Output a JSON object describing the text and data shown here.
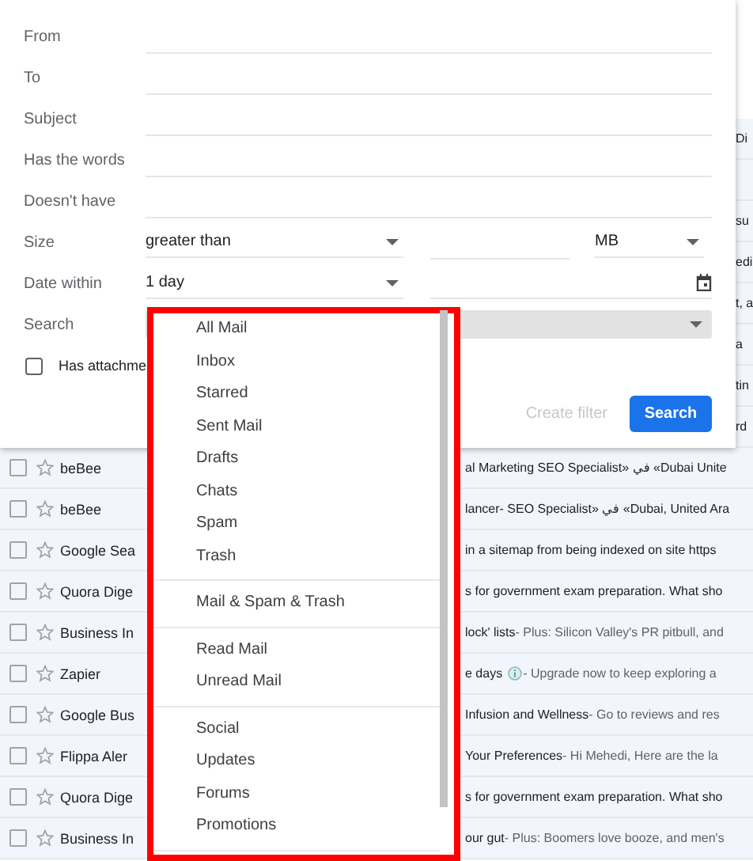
{
  "mail_list": {
    "rows": [
      {
        "kind": "covered",
        "edge_text": "Di"
      },
      {
        "kind": "covered"
      },
      {
        "kind": "covered",
        "edge_text": "su"
      },
      {
        "kind": "covered",
        "edge_text": "edi"
      },
      {
        "kind": "covered",
        "edge_text": "t, a"
      },
      {
        "kind": "covered",
        "edge_text": "a"
      },
      {
        "kind": "covered",
        "edge_text": "tin"
      },
      {
        "kind": "covered",
        "edge_text": "rd"
      },
      {
        "kind": "email",
        "checked": false,
        "sender": "beBee",
        "subject": "al Marketing SEO Specialist» في «Dubai Unite"
      },
      {
        "kind": "email",
        "checked": false,
        "sender": "beBee",
        "subject": "lancer- SEO Specialist» في «Dubai, United Ara"
      },
      {
        "kind": "email",
        "checked": false,
        "sender": "Google Sea",
        "subject": "in a sitemap from being indexed on site https"
      },
      {
        "kind": "email",
        "checked": false,
        "sender": "Quora Dige",
        "subject": "s for government exam preparation. What sho"
      },
      {
        "kind": "email",
        "checked": false,
        "sender": "Business In",
        "subject": "lock' lists",
        "snippet": " - Plus: Silicon Valley's PR pitbull, and"
      },
      {
        "kind": "email",
        "checked": false,
        "sender": "Zapier",
        "subject": "e days",
        "info_icon": true,
        "snippet": " - Upgrade now to keep exploring a"
      },
      {
        "kind": "email",
        "checked": false,
        "sender": "Google Bus",
        "subject": "Infusion and Wellness",
        "snippet": " - Go to reviews and res"
      },
      {
        "kind": "email",
        "checked": false,
        "sender": "Flippa Aler",
        "subject": "Your Preferences",
        "snippet": " - Hi Mehedi, Here are the la"
      },
      {
        "kind": "email",
        "checked": false,
        "sender": "Quora Dige",
        "subject": "s for government exam preparation. What sho"
      },
      {
        "kind": "email",
        "checked": false,
        "sender": "Business In",
        "subject": "our gut",
        "snippet": " - Plus: Boomers love booze, and men's"
      }
    ]
  },
  "search_dialog": {
    "text_fields": [
      {
        "label": "From"
      },
      {
        "label": "To"
      },
      {
        "label": "Subject"
      },
      {
        "label": "Has the words"
      },
      {
        "label": "Doesn't have"
      }
    ],
    "size": {
      "label": "Size",
      "comparator": "greater than",
      "unit": "MB"
    },
    "date_within": {
      "label": "Date within",
      "value": "1 day"
    },
    "search": {
      "label": "Search"
    },
    "has_attachment": {
      "label": "Has attachme",
      "checked": false
    },
    "create_filter": {
      "label": "Create filter",
      "disabled": true
    },
    "search_button": {
      "label": "Search"
    }
  },
  "label_menu": {
    "groups": [
      {
        "items": [
          {
            "label": "All Mail"
          },
          {
            "label": "Inbox"
          },
          {
            "label": "Starred"
          },
          {
            "label": "Sent Mail"
          },
          {
            "label": "Drafts"
          },
          {
            "label": "Chats"
          },
          {
            "label": "Spam"
          },
          {
            "label": "Trash"
          }
        ]
      },
      {
        "items": [
          {
            "label": "Mail & Spam & Trash"
          }
        ]
      },
      {
        "items": [
          {
            "label": "Read Mail"
          },
          {
            "label": "Unread Mail"
          }
        ]
      },
      {
        "items": [
          {
            "label": "Social"
          },
          {
            "label": "Updates"
          },
          {
            "label": "Forums"
          },
          {
            "label": "Promotions"
          }
        ]
      }
    ]
  }
}
